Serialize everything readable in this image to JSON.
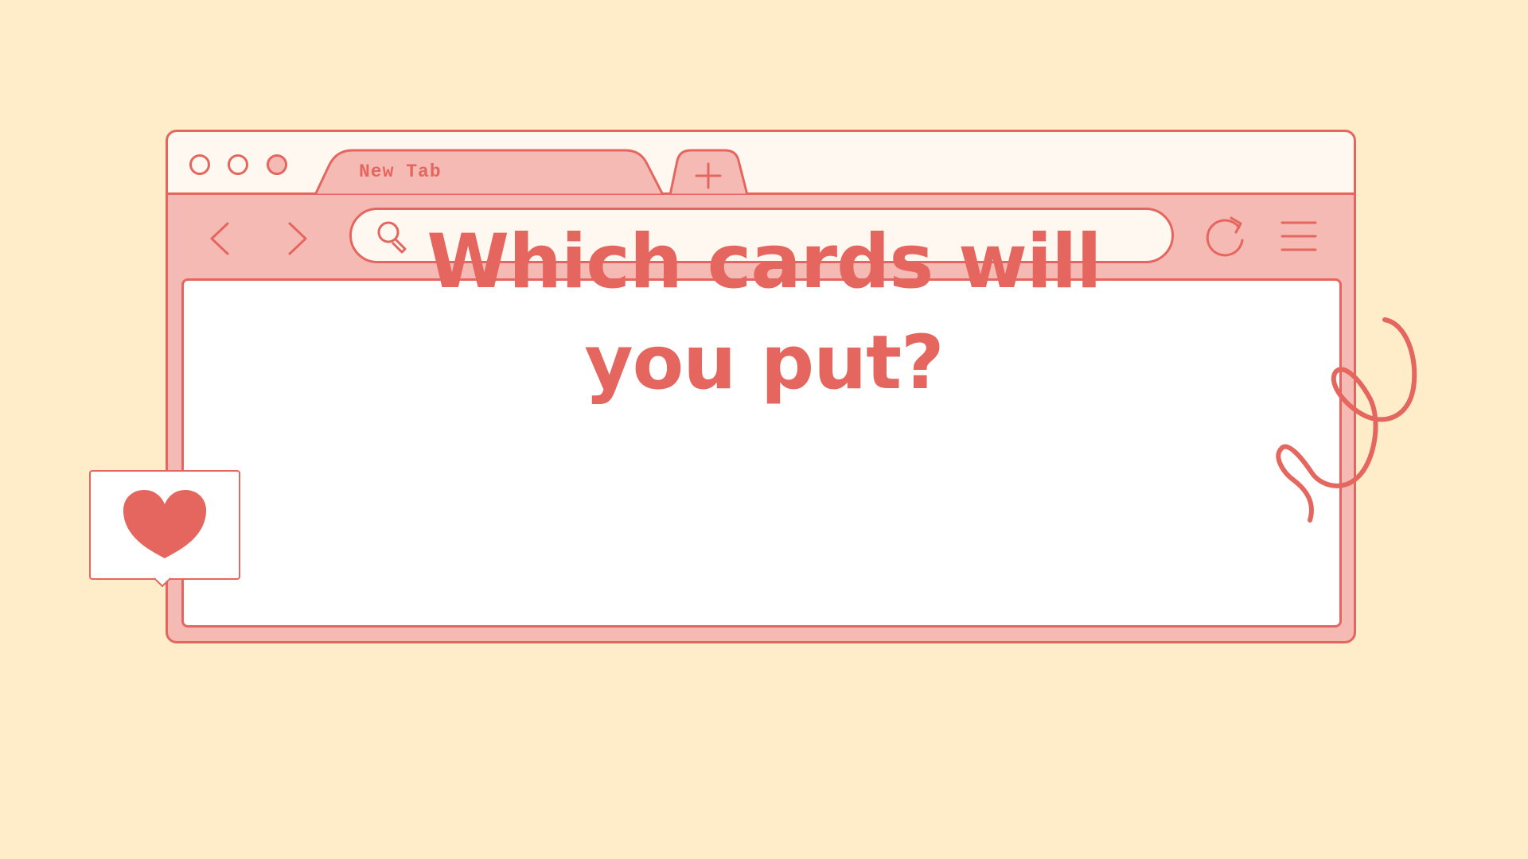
{
  "tab": {
    "title": "New Tab"
  },
  "address_bar": {
    "value": "",
    "placeholder": ""
  },
  "content": {
    "headline_line1": "Which cards will",
    "headline_line2": "you put?"
  },
  "colors": {
    "accent": "#E5665E",
    "pink": "#F6BAB5",
    "background": "#FFECC9",
    "cream": "#FFF8F0",
    "white": "#FFFFFF"
  },
  "icons": {
    "window_dots": [
      "circle-icon",
      "circle-icon",
      "circle-icon"
    ],
    "new_tab": "plus-icon",
    "back": "chevron-left-icon",
    "forward": "chevron-right-icon",
    "search": "search-icon",
    "reload": "reload-icon",
    "menu": "hamburger-menu-icon",
    "like": "heart-icon",
    "decoration": "squiggle-icon"
  }
}
